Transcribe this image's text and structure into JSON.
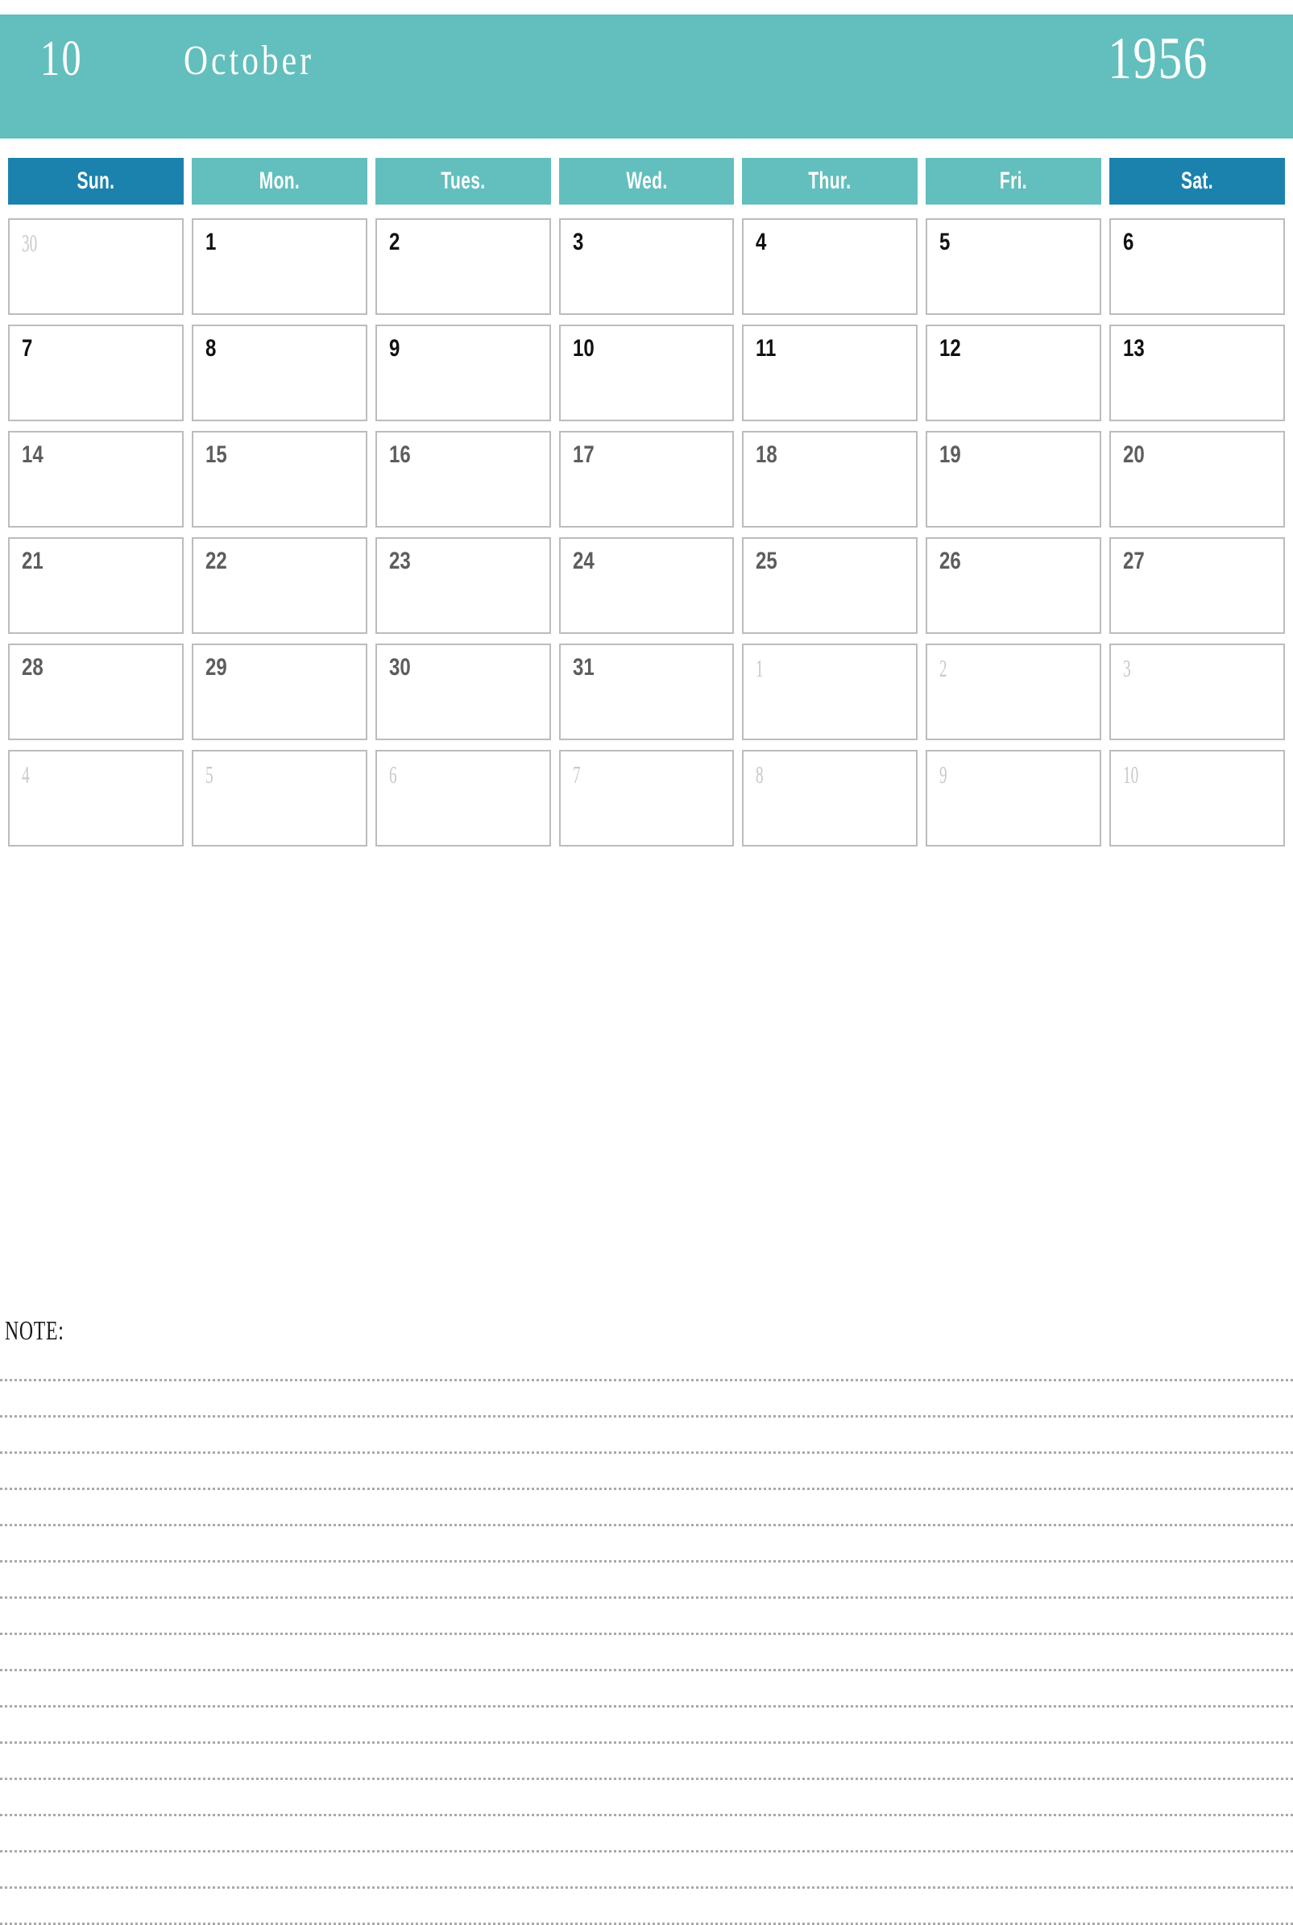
{
  "header": {
    "month_number": "10",
    "month_name": "October",
    "year": "1956",
    "background_color": "#62bfbd",
    "text_color": "#ffffff"
  },
  "weekdays": [
    {
      "label": "Sun.",
      "accent": true,
      "color": "#1b82ad"
    },
    {
      "label": "Mon.",
      "accent": false,
      "color": "#62bfbd"
    },
    {
      "label": "Tues.",
      "accent": false,
      "color": "#62bfbd"
    },
    {
      "label": "Wed.",
      "accent": false,
      "color": "#62bfbd"
    },
    {
      "label": "Thur.",
      "accent": false,
      "color": "#62bfbd"
    },
    {
      "label": "Fri.",
      "accent": false,
      "color": "#62bfbd"
    },
    {
      "label": "Sat.",
      "accent": true,
      "color": "#1b82ad"
    }
  ],
  "weeks": [
    [
      {
        "day": "30",
        "current_month": false
      },
      {
        "day": "1",
        "current_month": true
      },
      {
        "day": "2",
        "current_month": true
      },
      {
        "day": "3",
        "current_month": true
      },
      {
        "day": "4",
        "current_month": true
      },
      {
        "day": "5",
        "current_month": true
      },
      {
        "day": "6",
        "current_month": true
      }
    ],
    [
      {
        "day": "7",
        "current_month": true
      },
      {
        "day": "8",
        "current_month": true
      },
      {
        "day": "9",
        "current_month": true
      },
      {
        "day": "10",
        "current_month": true
      },
      {
        "day": "11",
        "current_month": true
      },
      {
        "day": "12",
        "current_month": true
      },
      {
        "day": "13",
        "current_month": true
      }
    ],
    [
      {
        "day": "14",
        "current_month": true
      },
      {
        "day": "15",
        "current_month": true
      },
      {
        "day": "16",
        "current_month": true
      },
      {
        "day": "17",
        "current_month": true
      },
      {
        "day": "18",
        "current_month": true
      },
      {
        "day": "19",
        "current_month": true
      },
      {
        "day": "20",
        "current_month": true
      }
    ],
    [
      {
        "day": "21",
        "current_month": true
      },
      {
        "day": "22",
        "current_month": true
      },
      {
        "day": "23",
        "current_month": true
      },
      {
        "day": "24",
        "current_month": true
      },
      {
        "day": "25",
        "current_month": true
      },
      {
        "day": "26",
        "current_month": true
      },
      {
        "day": "27",
        "current_month": true
      }
    ],
    [
      {
        "day": "28",
        "current_month": true
      },
      {
        "day": "29",
        "current_month": true
      },
      {
        "day": "30",
        "current_month": true
      },
      {
        "day": "31",
        "current_month": true
      },
      {
        "day": "1",
        "current_month": false
      },
      {
        "day": "2",
        "current_month": false
      },
      {
        "day": "3",
        "current_month": false
      }
    ],
    [
      {
        "day": "4",
        "current_month": false
      },
      {
        "day": "5",
        "current_month": false
      },
      {
        "day": "6",
        "current_month": false
      },
      {
        "day": "7",
        "current_month": false
      },
      {
        "day": "8",
        "current_month": false
      },
      {
        "day": "9",
        "current_month": false
      },
      {
        "day": "10",
        "current_month": false
      }
    ]
  ],
  "note": {
    "label": "NOTE:",
    "line_count": 16
  },
  "colors": {
    "teal": "#62bfbd",
    "blue": "#1b82ad",
    "cell_border": "#bcbcbc",
    "day_text": "#111111",
    "day_text_muted": "#5d5d5d",
    "other_month_text": "#c9c9c9",
    "note_line": "#a9a9a9"
  }
}
